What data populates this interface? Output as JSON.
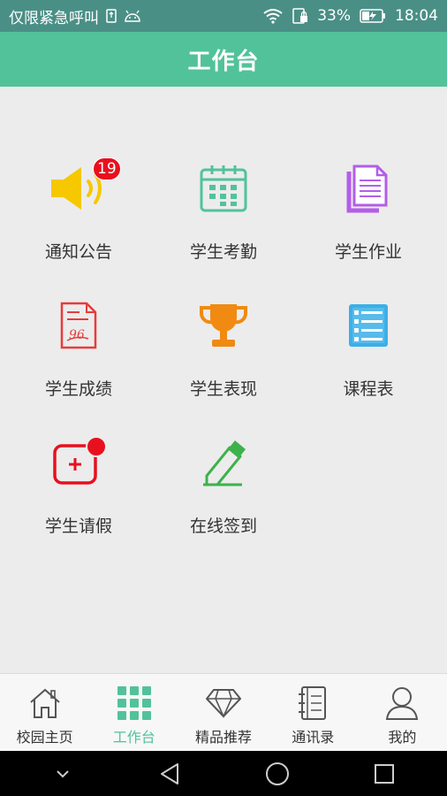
{
  "status_bar": {
    "carrier_text": "仅限紧急呼叫",
    "battery_percent": "33%",
    "time": "18:04",
    "icons": [
      "sim-icon",
      "android-icon",
      "wifi-icon",
      "sim-lock-icon",
      "battery-charging-icon"
    ]
  },
  "header": {
    "title": "工作台"
  },
  "tiles": [
    {
      "label": "通知公告",
      "icon": "speaker-icon",
      "badge": "19",
      "color": "#f5c800"
    },
    {
      "label": "学生考勤",
      "icon": "calendar-icon",
      "color": "#52c29b"
    },
    {
      "label": "学生作业",
      "icon": "document-icon",
      "color": "#b35ee8"
    },
    {
      "label": "学生成绩",
      "icon": "score-paper-icon",
      "color": "#e83b3b"
    },
    {
      "label": "学生表现",
      "icon": "trophy-icon",
      "color": "#f08a12"
    },
    {
      "label": "课程表",
      "icon": "schedule-icon",
      "color": "#3ab0e8"
    },
    {
      "label": "学生请假",
      "icon": "medical-icon",
      "has_dot": true,
      "color": "#e8101e"
    },
    {
      "label": "在线签到",
      "icon": "pen-icon",
      "color": "#3cb24a"
    }
  ],
  "bottom_nav": [
    {
      "label": "校园主页",
      "icon": "home-icon",
      "active": false
    },
    {
      "label": "工作台",
      "icon": "grid-icon",
      "active": true
    },
    {
      "label": "精品推荐",
      "icon": "diamond-icon",
      "active": false
    },
    {
      "label": "通讯录",
      "icon": "contacts-icon",
      "active": false
    },
    {
      "label": "我的",
      "icon": "user-icon",
      "active": false
    }
  ],
  "colors": {
    "accent": "#52c29b",
    "status_bar": "#4a8f86",
    "badge": "#e8101e"
  }
}
